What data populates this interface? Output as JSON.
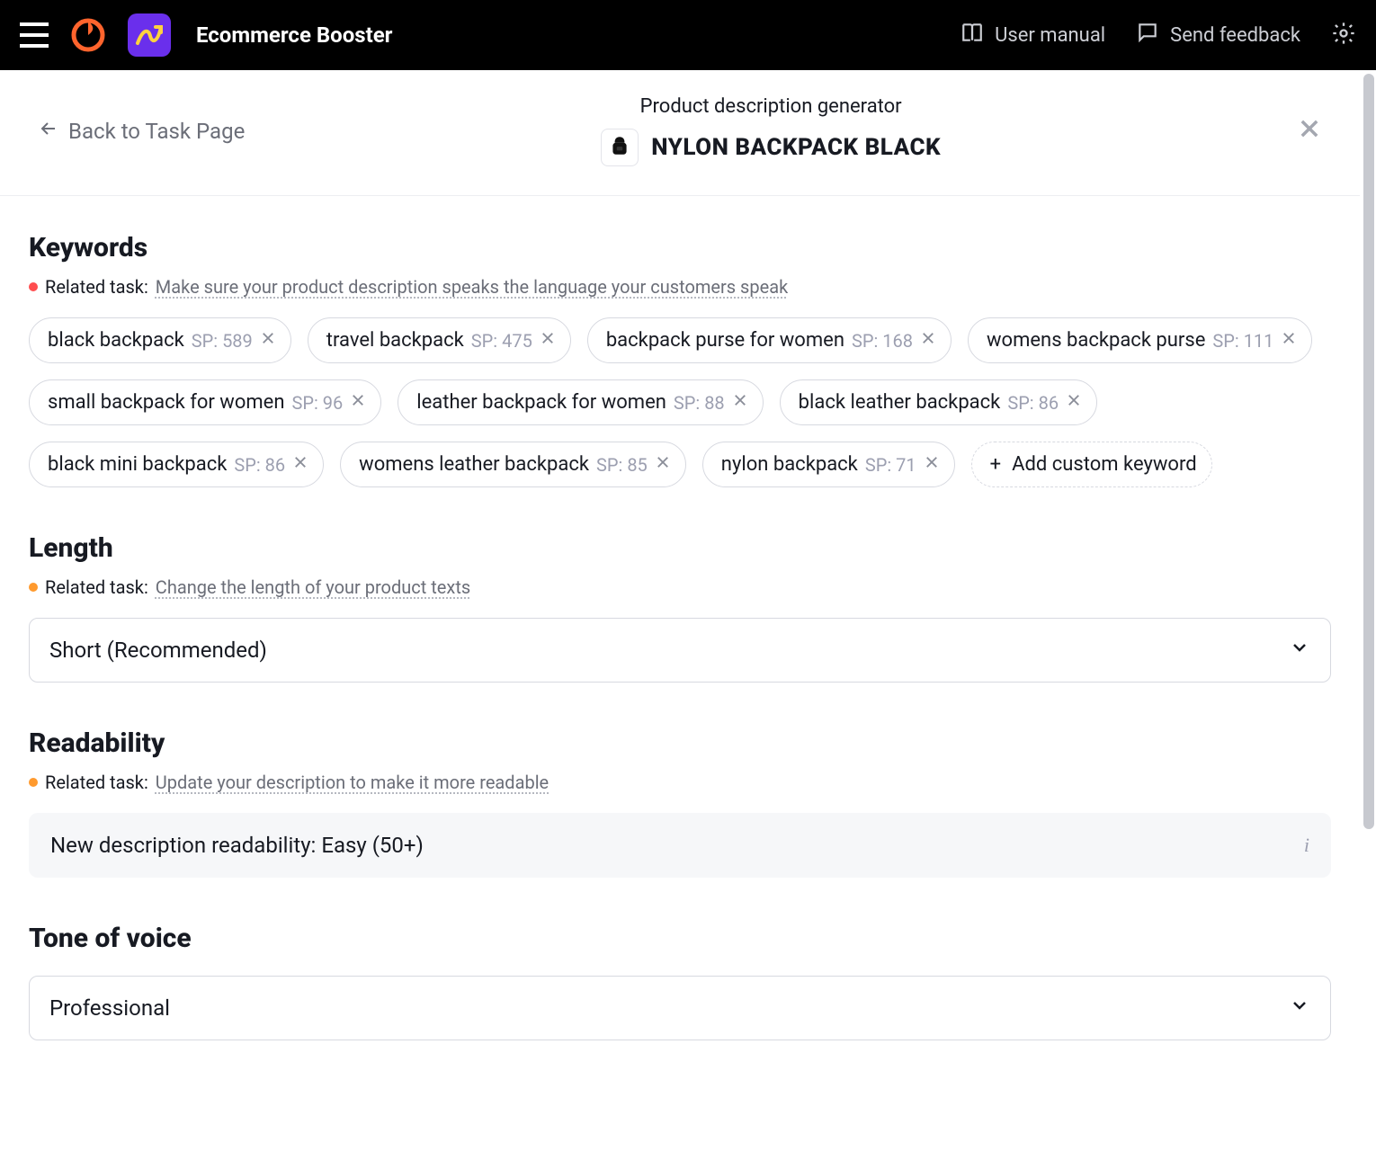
{
  "topbar": {
    "app_title": "Ecommerce Booster",
    "user_manual": "User manual",
    "send_feedback": "Send feedback"
  },
  "page_head": {
    "back_label": "Back to Task Page",
    "subtitle": "Product description generator",
    "product_name": "NYLON BACKPACK BLACK"
  },
  "keywords": {
    "title": "Keywords",
    "related_prefix": "Related task:",
    "related_link": "Make sure your product description speaks the language your customers speak",
    "chips": [
      {
        "text": "black backpack",
        "sp": "SP: 589"
      },
      {
        "text": "travel backpack",
        "sp": "SP: 475"
      },
      {
        "text": "backpack purse for women",
        "sp": "SP: 168"
      },
      {
        "text": "womens backpack purse",
        "sp": "SP: 111"
      },
      {
        "text": "small backpack for women",
        "sp": "SP: 96"
      },
      {
        "text": "leather backpack for women",
        "sp": "SP: 88"
      },
      {
        "text": "black leather backpack",
        "sp": "SP: 86"
      },
      {
        "text": "black mini backpack",
        "sp": "SP: 86"
      },
      {
        "text": "womens leather backpack",
        "sp": "SP: 85"
      },
      {
        "text": "nylon backpack",
        "sp": "SP: 71"
      }
    ],
    "add_label": "Add custom keyword"
  },
  "length": {
    "title": "Length",
    "related_prefix": "Related task:",
    "related_link": "Change the length of your product texts",
    "selected": "Short (Recommended)"
  },
  "readability": {
    "title": "Readability",
    "related_prefix": "Related task:",
    "related_link": "Update your description to make it more readable",
    "info_text": "New description readability: Easy (50+)"
  },
  "tone": {
    "title": "Tone of voice",
    "selected": "Professional"
  }
}
